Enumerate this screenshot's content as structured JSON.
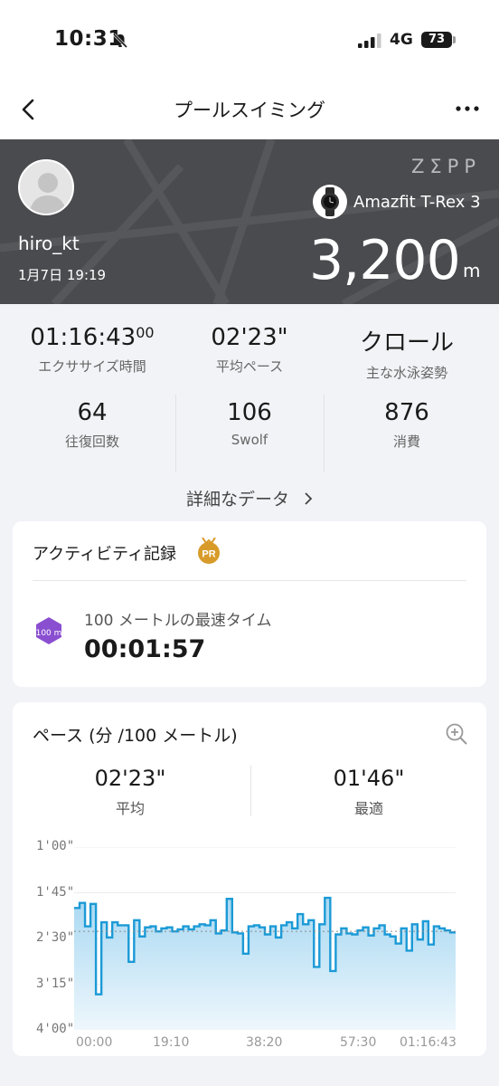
{
  "status": {
    "time": "10:31",
    "network": "4G",
    "battery": "73"
  },
  "nav": {
    "title": "プールスイミング"
  },
  "hero": {
    "username": "hiro_kt",
    "datetime": "1月7日 19:19",
    "brand": "ZΣPP",
    "device": "Amazfit T-Rex 3",
    "distance": "3,200",
    "distance_unit": "m"
  },
  "stats": {
    "duration": "01:16:43",
    "duration_frac": "00",
    "duration_label": "エクササイズ時間",
    "avg_pace": "02'23\"",
    "avg_pace_label": "平均ペース",
    "stroke": "クロール",
    "stroke_label": "主な水泳姿勢",
    "laps": "64",
    "laps_label": "往復回数",
    "swolf": "106",
    "swolf_label": "Swolf",
    "calories": "876",
    "calories_label": "消費"
  },
  "details_link": "詳細なデータ",
  "activity": {
    "title": "アクティビティ記録",
    "pr_badge": "PR",
    "record_badge": "100 m",
    "record_label": "100 メートルの最速タイム",
    "record_value": "00:01:57"
  },
  "pace_card": {
    "title": "ペース (分 /100 メートル)",
    "avg_value": "02'23\"",
    "avg_label": "平均",
    "best_value": "01'46\"",
    "best_label": "最適"
  },
  "colors": {
    "hero_bg": "#4a4b4f",
    "chart_line": "#1b9ad6",
    "chart_fill": "#a8d8f2",
    "pr_gold": "#d89b2a",
    "badge_purple": "#8a4fd0"
  },
  "chart_data": {
    "type": "area",
    "title": "ペース (分 /100 メートル)",
    "xlabel": "",
    "ylabel": "",
    "x_ticks": [
      "00:00",
      "19:10",
      "38:20",
      "57:30",
      "01:16:43"
    ],
    "y_ticks": [
      "1'00\"",
      "1'45\"",
      "2'30\"",
      "3'15\"",
      "4'00\""
    ],
    "y_range_seconds": [
      60,
      240
    ],
    "y_inverted": true,
    "avg_line_seconds": 143,
    "series": [
      {
        "values_seconds": [
          120,
          115,
          138,
          116,
          205,
          134,
          149,
          134,
          137,
          137,
          173,
          132,
          148,
          139,
          138,
          143,
          140,
          139,
          143,
          141,
          138,
          141,
          138,
          136,
          137,
          132,
          145,
          142,
          111,
          144,
          145,
          165,
          138,
          137,
          139,
          146,
          138,
          149,
          137,
          134,
          140,
          126,
          136,
          132,
          178,
          136,
          110,
          182,
          146,
          140,
          145,
          146,
          142,
          139,
          147,
          140,
          137,
          146,
          148,
          155,
          140,
          162,
          136,
          151,
          133,
          156,
          138,
          140,
          142,
          144
        ]
      }
    ]
  }
}
